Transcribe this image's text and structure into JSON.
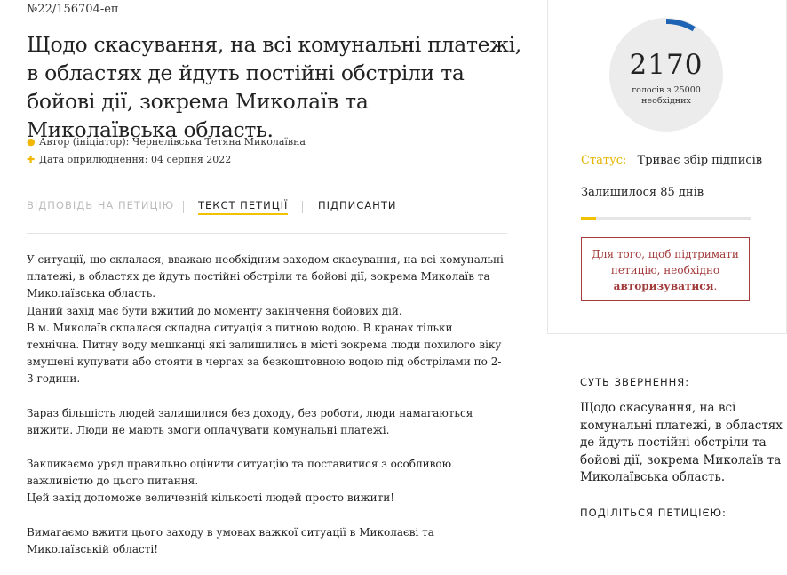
{
  "petition": {
    "number": "№22/156704-еп",
    "title": "Щодо скасування, на всі комунальні платежі, в областях де йдуть постійні обстріли та бойові дії, зокрема Миколаїв та Миколаївська область.",
    "author_label": "Автор (ініціатор): Чернелівська Тетяна Миколаївна",
    "date_label": "Дата оприлюднення: 04 серпня 2022"
  },
  "tabs": {
    "answer": "ВІДПОВІДЬ НА ПЕТИЦІЮ",
    "text": "ТЕКСТ ПЕТИЦІЇ",
    "signers": "ПІДПИСАНТИ",
    "active": "text"
  },
  "body": {
    "p1": "У ситуації, що склалася, вважаю необхідним заходом скасування, на всі комунальні платежі, в областях де йдуть постійні обстріли та бойові дії, зокрема Миколаїв та Миколаївська область.",
    "p1b": "Даний захід має бути вжитий до моменту закінчення бойових дій.",
    "p1c": "В м. Миколаїв склалася складна ситуація з питною водою. В кранах тільки технічна. Питну воду мешканці які залишились в місті зокрема люди похилого віку змушені купувати або стояти в чергах за безкоштовною водою під обстрілами по 2-3 години.",
    "p2": "Зараз більшість людей залишилися без доходу, без роботи, люди намагаються вижити. Люди не мають змоги оплачувати комунальні платежі.",
    "p3": "Закликаємо уряд правильно оцінити ситуацію та поставитися з особливою важливістю до цього питання.",
    "p3b": "Цей захід допоможе величезній кількості людей просто вижити!",
    "p4": "Вимагаємо вжити цього заходу в умовах важкої ситуації в Миколаєві та Миколаївській області!"
  },
  "sidebar": {
    "votes": "2170",
    "votes_sub": "голосів з 25000 необхідних",
    "votes_value": 2170,
    "votes_target": 25000,
    "status_label": "Статус:",
    "status_value": "Триває збір підписів",
    "remaining": "Залишилося 85 днів",
    "auth_text": "Для того, щоб підтримати петицію, необхідно",
    "auth_link": "авторизуватися",
    "auth_end": ".",
    "summary_heading": "СУТЬ ЗВЕРНЕННЯ:",
    "summary_text": "Щодо скасування, на всі комунальні платежі, в областях де йдуть постійні обстріли та бойові дії, зокрема Миколаїв та Миколаївська область.",
    "share_heading": "ПОДІЛІТЬСЯ ПЕТИЦІЄЮ:"
  },
  "colors": {
    "accent": "#f2c200",
    "counter_arc": "#1e63b4",
    "alert": "#a23b3b"
  }
}
